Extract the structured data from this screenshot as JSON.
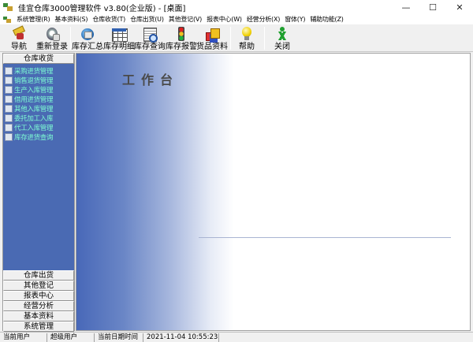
{
  "window": {
    "title": "佳宜仓库3000管理软件 v3.80(企业版) - [桌面]",
    "min_glyph": "—",
    "max_glyph": "☐",
    "close_glyph": "✕"
  },
  "menu": [
    "系统管理(R)",
    "基本资料(S)",
    "仓库收货(T)",
    "仓库出货(U)",
    "其他登记(V)",
    "报表中心(W)",
    "经营分析(X)",
    "窗体(Y)",
    "辅助功能(Z)"
  ],
  "toolbar": {
    "nav": "导航",
    "relogin": "重新登录",
    "summary": "库存汇总",
    "detail": "库存明细",
    "query": "库存查询",
    "alarm": "库存报警",
    "goods": "货品资料",
    "help": "帮助",
    "close": "关闭"
  },
  "sidebar": {
    "active_section": "仓库收货",
    "items": [
      "采购进货管理",
      "销售退货管理",
      "生产入库管理",
      "借用进货管理",
      "其他入库管理",
      "委托加工入库",
      "代工入库管理",
      "库存进货查询"
    ],
    "sections": [
      "仓库出货",
      "其他登记",
      "报表中心",
      "经营分析",
      "基本资料",
      "系统管理"
    ]
  },
  "workspace": {
    "title": "工作台"
  },
  "status": {
    "user_label": "当前用户",
    "user_value": "超级用户",
    "datetime_label": "当前日期时间",
    "datetime_value": "2021-11-04 10:55:23"
  },
  "colors": {
    "sidebar_bg": "#4a6ab3",
    "nav_text": "#7fffd4",
    "workspace_gradient_start": "#4868b8"
  }
}
